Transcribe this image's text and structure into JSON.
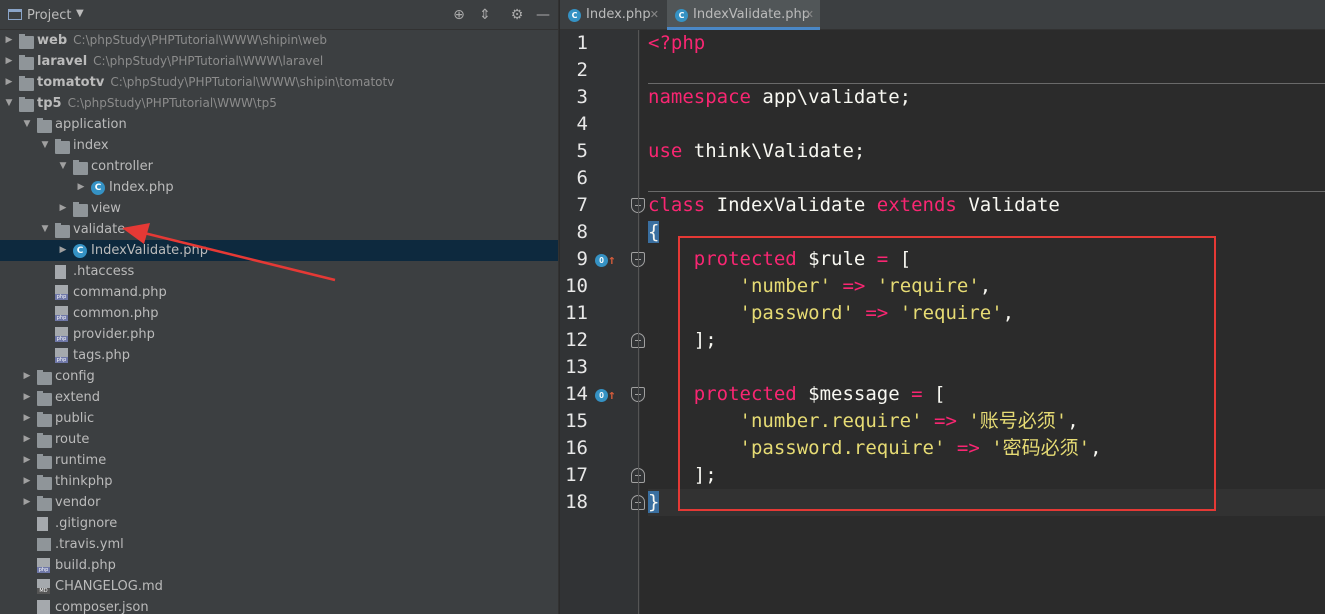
{
  "project_panel": {
    "title": "Project",
    "tree": [
      {
        "name": "web",
        "path": "C:\\phpStudy\\PHPTutorial\\WWW\\shipin\\web",
        "bold": true,
        "depth": 0,
        "type": "folder",
        "expanded": false
      },
      {
        "name": "laravel",
        "path": "C:\\phpStudy\\PHPTutorial\\WWW\\laravel",
        "bold": true,
        "depth": 0,
        "type": "folder",
        "expanded": false
      },
      {
        "name": "tomatotv",
        "path": "C:\\phpStudy\\PHPTutorial\\WWW\\shipin\\tomatotv",
        "bold": true,
        "depth": 0,
        "type": "folder",
        "expanded": false
      },
      {
        "name": "tp5",
        "path": "C:\\phpStudy\\PHPTutorial\\WWW\\tp5",
        "bold": true,
        "depth": 0,
        "type": "folder",
        "expanded": true
      },
      {
        "name": "application",
        "depth": 1,
        "type": "folder",
        "expanded": true
      },
      {
        "name": "index",
        "depth": 2,
        "type": "folder",
        "expanded": true
      },
      {
        "name": "controller",
        "depth": 3,
        "type": "folder",
        "expanded": true
      },
      {
        "name": "Index.php",
        "depth": 4,
        "type": "class",
        "expanded": false
      },
      {
        "name": "view",
        "depth": 3,
        "type": "folder",
        "expanded": false
      },
      {
        "name": "validate",
        "depth": 2,
        "type": "folder",
        "expanded": true
      },
      {
        "name": "IndexValidate.php",
        "depth": 3,
        "type": "class",
        "expanded": false,
        "selected": true
      },
      {
        "name": ".htaccess",
        "depth": 2,
        "type": "plain"
      },
      {
        "name": "command.php",
        "depth": 2,
        "type": "php"
      },
      {
        "name": "common.php",
        "depth": 2,
        "type": "php"
      },
      {
        "name": "provider.php",
        "depth": 2,
        "type": "php"
      },
      {
        "name": "tags.php",
        "depth": 2,
        "type": "php"
      },
      {
        "name": "config",
        "depth": 1,
        "type": "folder",
        "expanded": false
      },
      {
        "name": "extend",
        "depth": 1,
        "type": "folder",
        "expanded": false
      },
      {
        "name": "public",
        "depth": 1,
        "type": "folder",
        "expanded": false
      },
      {
        "name": "route",
        "depth": 1,
        "type": "folder",
        "expanded": false
      },
      {
        "name": "runtime",
        "depth": 1,
        "type": "folder",
        "expanded": false
      },
      {
        "name": "thinkphp",
        "depth": 1,
        "type": "folder",
        "expanded": false
      },
      {
        "name": "vendor",
        "depth": 1,
        "type": "folder",
        "expanded": false
      },
      {
        "name": ".gitignore",
        "depth": 1,
        "type": "plain"
      },
      {
        "name": ".travis.yml",
        "depth": 1,
        "type": "yml"
      },
      {
        "name": "build.php",
        "depth": 1,
        "type": "php"
      },
      {
        "name": "CHANGELOG.md",
        "depth": 1,
        "type": "md"
      },
      {
        "name": "composer.json",
        "depth": 1,
        "type": "json"
      }
    ]
  },
  "editor": {
    "tabs": [
      {
        "label": "Index.php",
        "active": false
      },
      {
        "label": "IndexValidate.php",
        "active": true
      }
    ],
    "lines": [
      {
        "n": "1",
        "tokens": [
          [
            "tag",
            "<?php"
          ]
        ]
      },
      {
        "n": "2",
        "tokens": []
      },
      {
        "n": "3",
        "tokens": [
          [
            "kw",
            "namespace"
          ],
          [
            "plain",
            " app\\validate;"
          ]
        ]
      },
      {
        "n": "4",
        "tokens": []
      },
      {
        "n": "5",
        "tokens": [
          [
            "kw",
            "use"
          ],
          [
            "plain",
            " think\\Validate;"
          ]
        ]
      },
      {
        "n": "6",
        "tokens": []
      },
      {
        "n": "7",
        "tokens": [
          [
            "kw",
            "class"
          ],
          [
            "plain",
            " IndexValidate "
          ],
          [
            "kw",
            "extends"
          ],
          [
            "plain",
            " Validate"
          ]
        ]
      },
      {
        "n": "8",
        "tokens": [
          [
            "brace",
            "{"
          ]
        ]
      },
      {
        "n": "9",
        "tokens": [
          [
            "plain",
            "    "
          ],
          [
            "kw",
            "protected"
          ],
          [
            "plain",
            " $rule "
          ],
          [
            "op",
            "="
          ],
          [
            "plain",
            " ["
          ]
        ]
      },
      {
        "n": "10",
        "tokens": [
          [
            "plain",
            "        "
          ],
          [
            "str",
            "'number'"
          ],
          [
            "plain",
            " "
          ],
          [
            "op",
            "=>"
          ],
          [
            "plain",
            " "
          ],
          [
            "str",
            "'require'"
          ],
          [
            "plain",
            ","
          ]
        ]
      },
      {
        "n": "11",
        "tokens": [
          [
            "plain",
            "        "
          ],
          [
            "str",
            "'password'"
          ],
          [
            "plain",
            " "
          ],
          [
            "op",
            "=>"
          ],
          [
            "plain",
            " "
          ],
          [
            "str",
            "'require'"
          ],
          [
            "plain",
            ","
          ]
        ]
      },
      {
        "n": "12",
        "tokens": [
          [
            "plain",
            "    ];"
          ]
        ]
      },
      {
        "n": "13",
        "tokens": []
      },
      {
        "n": "14",
        "tokens": [
          [
            "plain",
            "    "
          ],
          [
            "kw",
            "protected"
          ],
          [
            "plain",
            " $message "
          ],
          [
            "op",
            "="
          ],
          [
            "plain",
            " ["
          ]
        ]
      },
      {
        "n": "15",
        "tokens": [
          [
            "plain",
            "        "
          ],
          [
            "str",
            "'number.require'"
          ],
          [
            "plain",
            " "
          ],
          [
            "op",
            "=>"
          ],
          [
            "plain",
            " "
          ],
          [
            "str",
            "'账号必须'"
          ],
          [
            "plain",
            ","
          ]
        ]
      },
      {
        "n": "16",
        "tokens": [
          [
            "plain",
            "        "
          ],
          [
            "str",
            "'password.require'"
          ],
          [
            "plain",
            " "
          ],
          [
            "op",
            "=>"
          ],
          [
            "plain",
            " "
          ],
          [
            "str",
            "'密码必须'"
          ],
          [
            "plain",
            ","
          ]
        ]
      },
      {
        "n": "17",
        "tokens": [
          [
            "plain",
            "    ];"
          ]
        ]
      },
      {
        "n": "18",
        "tokens": [
          [
            "brace",
            "}"
          ]
        ],
        "current": true
      }
    ],
    "override_markers": [
      "9",
      "14"
    ],
    "fold_markers": [
      "7",
      "9",
      "12",
      "14",
      "17",
      "18"
    ]
  },
  "colors": {
    "keyword": "#f92672",
    "string": "#e6db74",
    "annotation": "#e53935"
  }
}
